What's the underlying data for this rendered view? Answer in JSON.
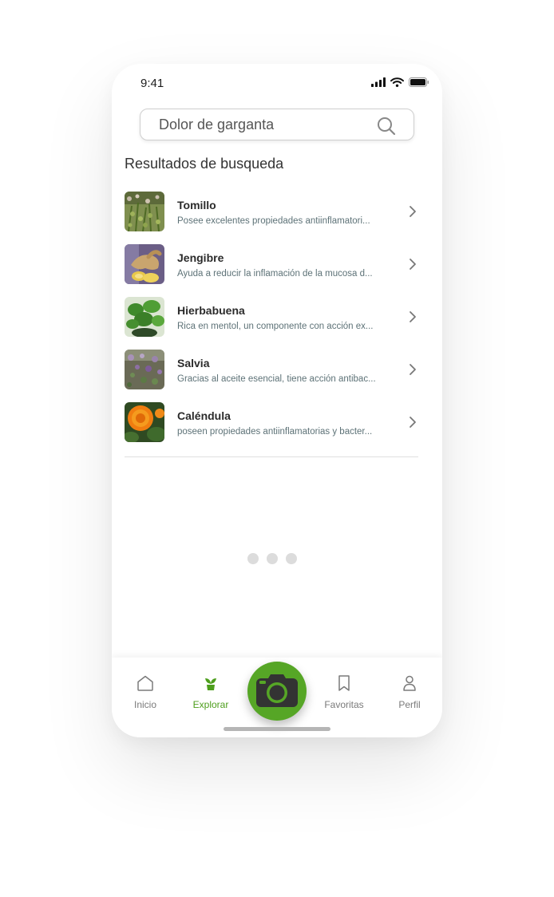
{
  "status_bar": {
    "time": "9:41"
  },
  "search": {
    "value": "Dolor de garganta"
  },
  "section_title": "Resultados de busqueda",
  "results": [
    {
      "title": "Tomillo",
      "description": "Posee excelentes propiedades antiinflamatori..."
    },
    {
      "title": "Jengibre",
      "description": "Ayuda a reducir la inflamación de la mucosa d..."
    },
    {
      "title": "Hierbabuena",
      "description": "Rica en mentol, un componente con acción ex..."
    },
    {
      "title": "Salvia",
      "description": "Gracias al aceite esencial, tiene acción antibac..."
    },
    {
      "title": "Caléndula",
      "description": "poseen propiedades antiinflamatorias y bacter..."
    }
  ],
  "tabbar": {
    "items": [
      {
        "label": "Inicio",
        "icon": "home-icon"
      },
      {
        "label": "Explorar",
        "icon": "sprout-icon",
        "active": true
      },
      {
        "label": "",
        "icon": "camera-icon"
      },
      {
        "label": "Favoritas",
        "icon": "bookmark-icon"
      },
      {
        "label": "Perfil",
        "icon": "user-icon"
      }
    ]
  },
  "colors": {
    "accent": "#56a626",
    "active_label": "#4d9e1c",
    "description_text": "#5d7277",
    "loader_dot": "#dcdcdc"
  }
}
